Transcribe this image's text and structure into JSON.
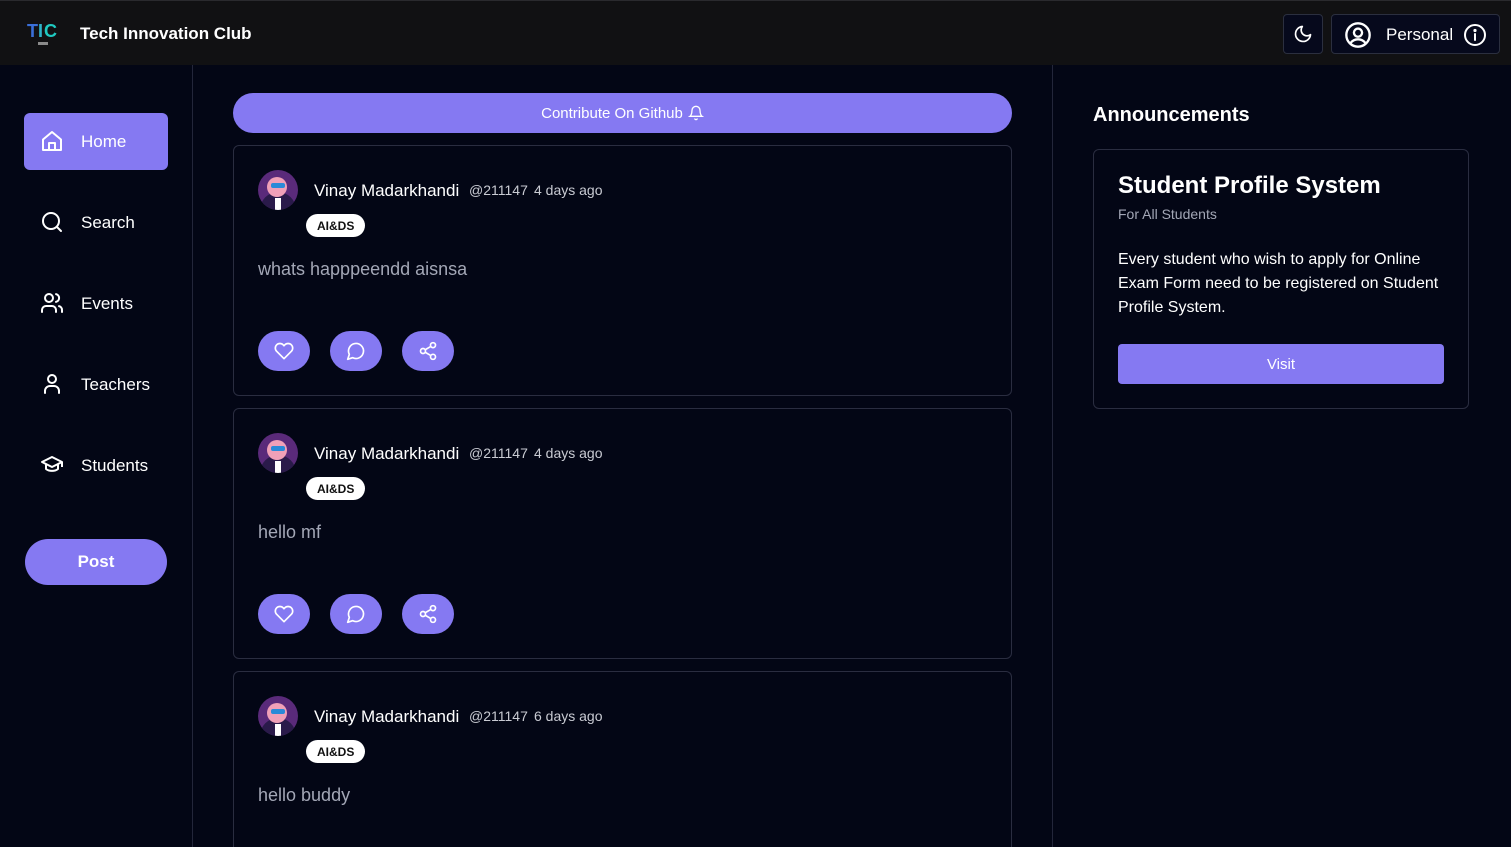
{
  "header": {
    "app_title": "Tech Innovation Club",
    "profile_label": "Personal",
    "icons": {
      "logo": "tic-club-logo",
      "theme": "moon-icon",
      "user": "user-circle-icon",
      "info": "info-icon"
    }
  },
  "sidebar": {
    "items": [
      {
        "label": "Home",
        "icon": "home-icon",
        "active": true
      },
      {
        "label": "Search",
        "icon": "search-icon",
        "active": false
      },
      {
        "label": "Events",
        "icon": "users-icon",
        "active": false
      },
      {
        "label": "Teachers",
        "icon": "user-icon",
        "active": false
      },
      {
        "label": "Students",
        "icon": "graduation-cap-icon",
        "active": false
      }
    ],
    "post_label": "Post"
  },
  "feed": {
    "contribute_label": "Contribute On Github",
    "posts": [
      {
        "author": "Vinay Madarkhandi",
        "handle": "@211147",
        "time": "4 days ago",
        "tag": "AI&DS",
        "content": "whats happpeendd aisnsa"
      },
      {
        "author": "Vinay Madarkhandi",
        "handle": "@211147",
        "time": "4 days ago",
        "tag": "AI&DS",
        "content": "hello mf"
      },
      {
        "author": "Vinay Madarkhandi",
        "handle": "@211147",
        "time": "6 days ago",
        "tag": "AI&DS",
        "content": "hello buddy"
      }
    ]
  },
  "announcements": {
    "title": "Announcements",
    "items": [
      {
        "heading": "Student Profile System",
        "audience": "For All Students",
        "body": "Every student who wish to apply for Online Exam Form need to be registered on Student Profile System.",
        "button_label": "Visit"
      }
    ]
  },
  "colors": {
    "accent": "#8579f2",
    "background": "#030615",
    "header": "#111113"
  }
}
